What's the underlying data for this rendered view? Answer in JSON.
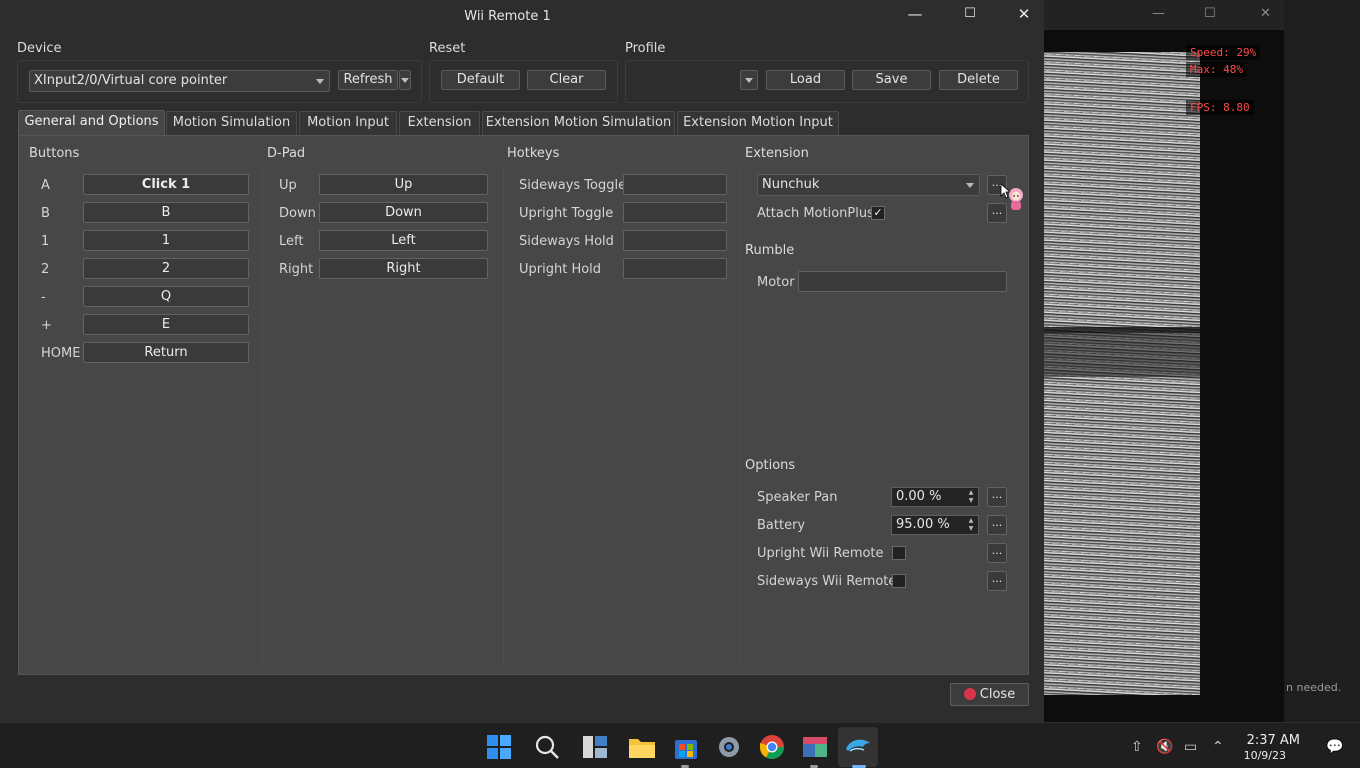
{
  "window": {
    "title": "Wii Remote 1",
    "minimize_glyph": "—",
    "maximize_glyph": "☐",
    "close_glyph": "✕"
  },
  "device": {
    "label": "Device",
    "selected": "XInput2/0/Virtual core pointer",
    "refresh_label": "Refresh"
  },
  "reset": {
    "label": "Reset",
    "default_label": "Default",
    "clear_label": "Clear"
  },
  "profile": {
    "label": "Profile",
    "selected": "",
    "load_label": "Load",
    "save_label": "Save",
    "delete_label": "Delete"
  },
  "tabs": [
    {
      "label": "General and Options",
      "active": true
    },
    {
      "label": "Motion Simulation",
      "active": false
    },
    {
      "label": "Motion Input",
      "active": false
    },
    {
      "label": "Extension",
      "active": false
    },
    {
      "label": "Extension Motion Simulation",
      "active": false
    },
    {
      "label": "Extension Motion Input",
      "active": false
    }
  ],
  "buttons": {
    "label": "Buttons",
    "rows": [
      {
        "name": "A",
        "value": "Click 1"
      },
      {
        "name": "B",
        "value": "B"
      },
      {
        "name": "1",
        "value": "1"
      },
      {
        "name": "2",
        "value": "2"
      },
      {
        "name": "-",
        "value": "Q"
      },
      {
        "name": "+",
        "value": "E"
      },
      {
        "name": "HOME",
        "value": "Return"
      }
    ]
  },
  "dpad": {
    "label": "D-Pad",
    "rows": [
      {
        "name": "Up",
        "value": "Up"
      },
      {
        "name": "Down",
        "value": "Down"
      },
      {
        "name": "Left",
        "value": "Left"
      },
      {
        "name": "Right",
        "value": "Right"
      }
    ]
  },
  "hotkeys": {
    "label": "Hotkeys",
    "rows": [
      {
        "name": "Sideways Toggle",
        "value": ""
      },
      {
        "name": "Upright Toggle",
        "value": ""
      },
      {
        "name": "Sideways Hold",
        "value": ""
      },
      {
        "name": "Upright Hold",
        "value": ""
      }
    ]
  },
  "extension": {
    "label": "Extension",
    "selected": "Nunchuk",
    "attach_motionplus_label": "Attach MotionPlus",
    "attach_motionplus_checked": true,
    "more_glyph": "..."
  },
  "rumble": {
    "label": "Rumble",
    "motor_label": "Motor",
    "motor_value": ""
  },
  "options": {
    "label": "Options",
    "speaker_pan_label": "Speaker Pan",
    "speaker_pan_value": "0.00 %",
    "battery_label": "Battery",
    "battery_value": "95.00 %",
    "upright_label": "Upright Wii Remote",
    "upright_checked": false,
    "sideways_label": "Sideways Wii Remote",
    "sideways_checked": false
  },
  "close_label": "Close",
  "game_window": {
    "osd_speed": "Speed:  29%",
    "osd_max": "Max:    48%",
    "osd_fps": "FPS:  8.80",
    "hint": "n  needed."
  },
  "taskbar": {
    "time": "2:37 AM",
    "date": "10/9/23",
    "icons": [
      "start-icon",
      "search-icon",
      "widgets-icon",
      "file-explorer-icon",
      "store-icon",
      "settings-icon",
      "chrome-icon",
      "app-icon",
      "dolphin-icon"
    ]
  },
  "colors": {
    "accent_start": "#2f8ff0",
    "close_red": "#d9334a",
    "osd_red": "#ff4a4a"
  }
}
